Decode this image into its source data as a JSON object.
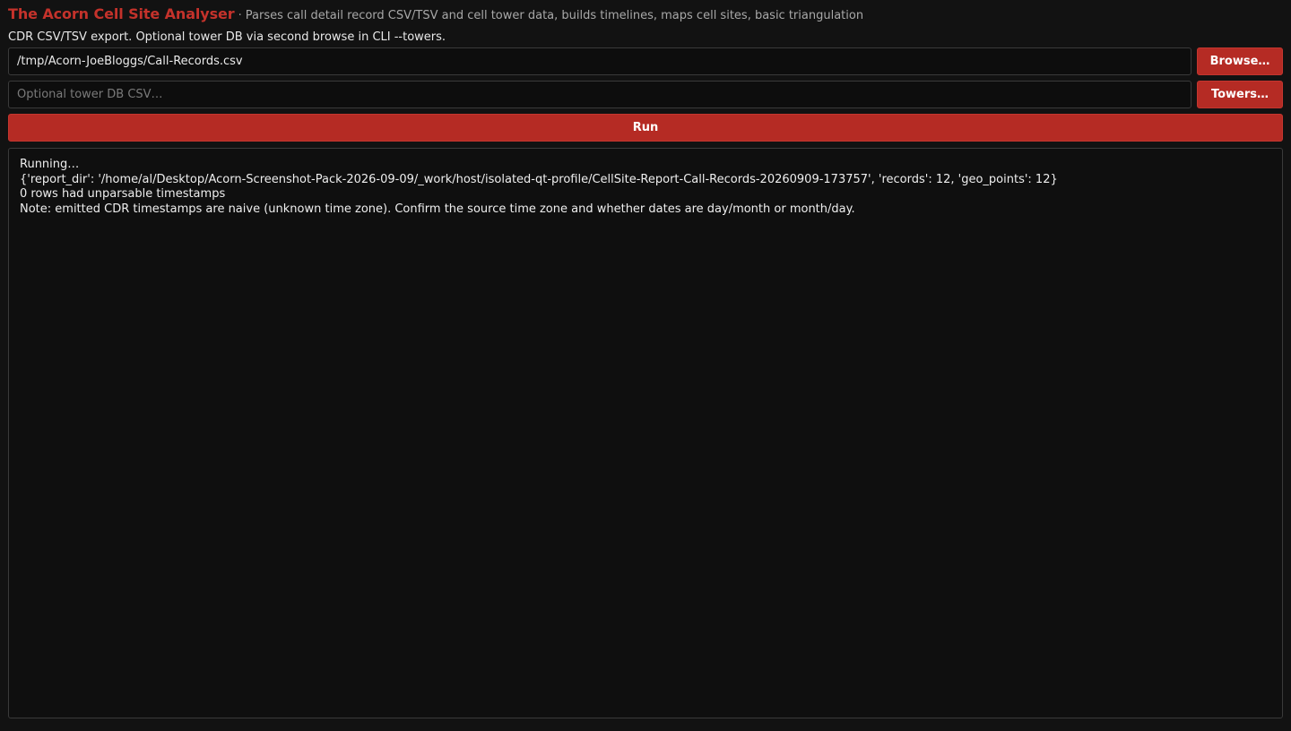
{
  "header": {
    "title": "The Acorn Cell Site Analyser",
    "separator": "·",
    "tagline": "Parses call detail record CSV/TSV and cell tower data, builds timelines, maps cell sites, basic triangulation"
  },
  "hint": "CDR CSV/TSV export. Optional tower DB via second browse in CLI --towers.",
  "cdr_input": {
    "value": "/tmp/Acorn-JoeBloggs/Call-Records.csv",
    "browse_label": "Browse…"
  },
  "tower_input": {
    "value": "",
    "placeholder": "Optional tower DB CSV…",
    "browse_label": "Towers…"
  },
  "run_label": "Run",
  "output": {
    "lines": [
      "Running…",
      "{'report_dir': '/home/al/Desktop/Acorn-Screenshot-Pack-2026-09-09/_work/host/isolated-qt-profile/CellSite-Report-Call-Records-20260909-173757', 'records': 12, 'geo_points': 12}",
      "0 rows had unparsable timestamps",
      "Note: emitted CDR timestamps are naive (unknown time zone). Confirm the source time zone and whether dates are day/month or month/day."
    ]
  },
  "colors": {
    "accent": "#b52b24",
    "background": "#121212"
  }
}
